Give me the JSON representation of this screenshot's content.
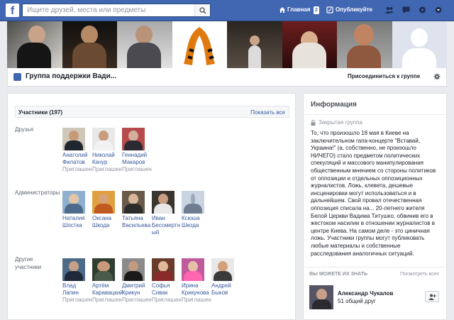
{
  "topbar": {
    "logo_letter": "f",
    "search_placeholder": "Ищите друзей, места или предметы",
    "home_label": "Главная",
    "home_count": "2",
    "publish_label": "Опубликуйте",
    "brand_color": "#4267b2"
  },
  "group": {
    "name": "Группа поддержки Вади...",
    "join_label": "Присоединиться к группе"
  },
  "members": {
    "title": "Участники (197)",
    "show_all": "Показать все",
    "sections": [
      {
        "label": "Друзья",
        "people": [
          {
            "name": "Анатолий Филатов",
            "status": "Приглашен"
          },
          {
            "name": "Николай Качур",
            "status": "Приглашен"
          },
          {
            "name": "Геннадий Макаров",
            "status": "Приглашен"
          }
        ]
      },
      {
        "label": "Администраторы",
        "people": [
          {
            "name": "Наталия Шостка",
            "status": ""
          },
          {
            "name": "Оксана Шкода",
            "status": ""
          },
          {
            "name": "Татьяна Васильева",
            "status": ""
          },
          {
            "name": "Иван Бессмертный",
            "status": ""
          },
          {
            "name": "Ксюша Шкода",
            "status": ""
          }
        ]
      },
      {
        "label": "Другие участники",
        "people": [
          {
            "name": "Влад Лапин",
            "status": "Приглашен"
          },
          {
            "name": "Артём Каравацкий",
            "status": "Приглашен"
          },
          {
            "name": "Дмитрий Крикун",
            "status": "Приглашен"
          },
          {
            "name": "Софья Сивак",
            "status": "Приглашен"
          },
          {
            "name": "Ирина Крикунова",
            "status": "Приглашен"
          },
          {
            "name": "Андрей Быков",
            "status": ""
          }
        ]
      }
    ]
  },
  "info": {
    "title": "Информация",
    "privacy": "Закрытая группа",
    "description": "То, что произошло 18 мая в Киеве на заключительном гапа-концерте \"Вставай, Украина!\" (а, собственно, не произошло НИЧЕГО) стало предметом политических спекуляций и массового манипулирования общественным мнением со стороны политиков от оппозиции и отдельных оппозиционных журналистов. Ложь, клевета, дешевые инсценировки могут использоваться и в дальнейшем. Свой провал отечественная оппозиция списала на... 20-летнего жителя Белой Церкви Вадима Титушко, обвинив его в жестоком насилии в отношении журналистов в центре Киева. На самом деле - это циничная ложь. Участники группы могут публиковать любые материалы и собственные расследования аналогичных ситуаций.",
    "pymk_title": "ВЫ МОЖЕТЕ ИХ ЗНАТЬ",
    "pymk_see_all": "Посмотреть всех",
    "pymk_person": {
      "name": "Александр Чукалов",
      "mutual": "51 общий друг"
    }
  }
}
